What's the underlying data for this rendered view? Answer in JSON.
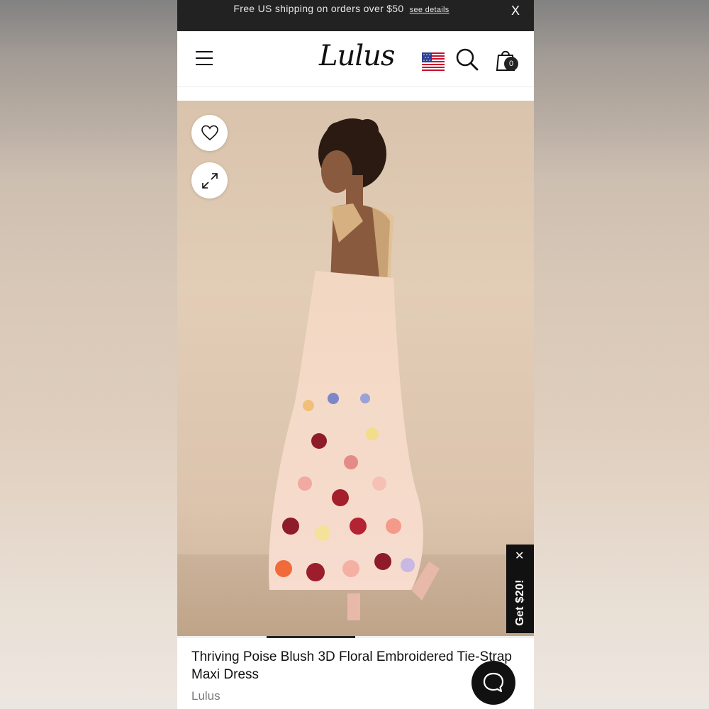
{
  "promo_bar": {
    "text": "Free US shipping on orders over $50",
    "link": "see details",
    "close": "X"
  },
  "header": {
    "logo": "Lulus",
    "cart_count": "0",
    "icons": [
      "menu-icon",
      "us-flag-icon",
      "search-icon",
      "shopping-bag-icon"
    ]
  },
  "image_actions": {
    "icons": [
      "heart-icon",
      "expand-icon"
    ]
  },
  "gallery": {
    "active_index": 2
  },
  "promo_tab": {
    "close": "✕",
    "label": "Get $20!"
  },
  "product": {
    "title": "Thriving Poise Blush 3D Floral Embroidered Tie-Strap Maxi Dress",
    "brand": "Lulus"
  },
  "chat": {
    "icon": "chat-bubble-icon"
  },
  "colors": {
    "promo_bar_bg": "#222222",
    "text_primary": "#111111",
    "text_secondary": "#7a7a7a",
    "image_bg": "#ddc6af"
  }
}
